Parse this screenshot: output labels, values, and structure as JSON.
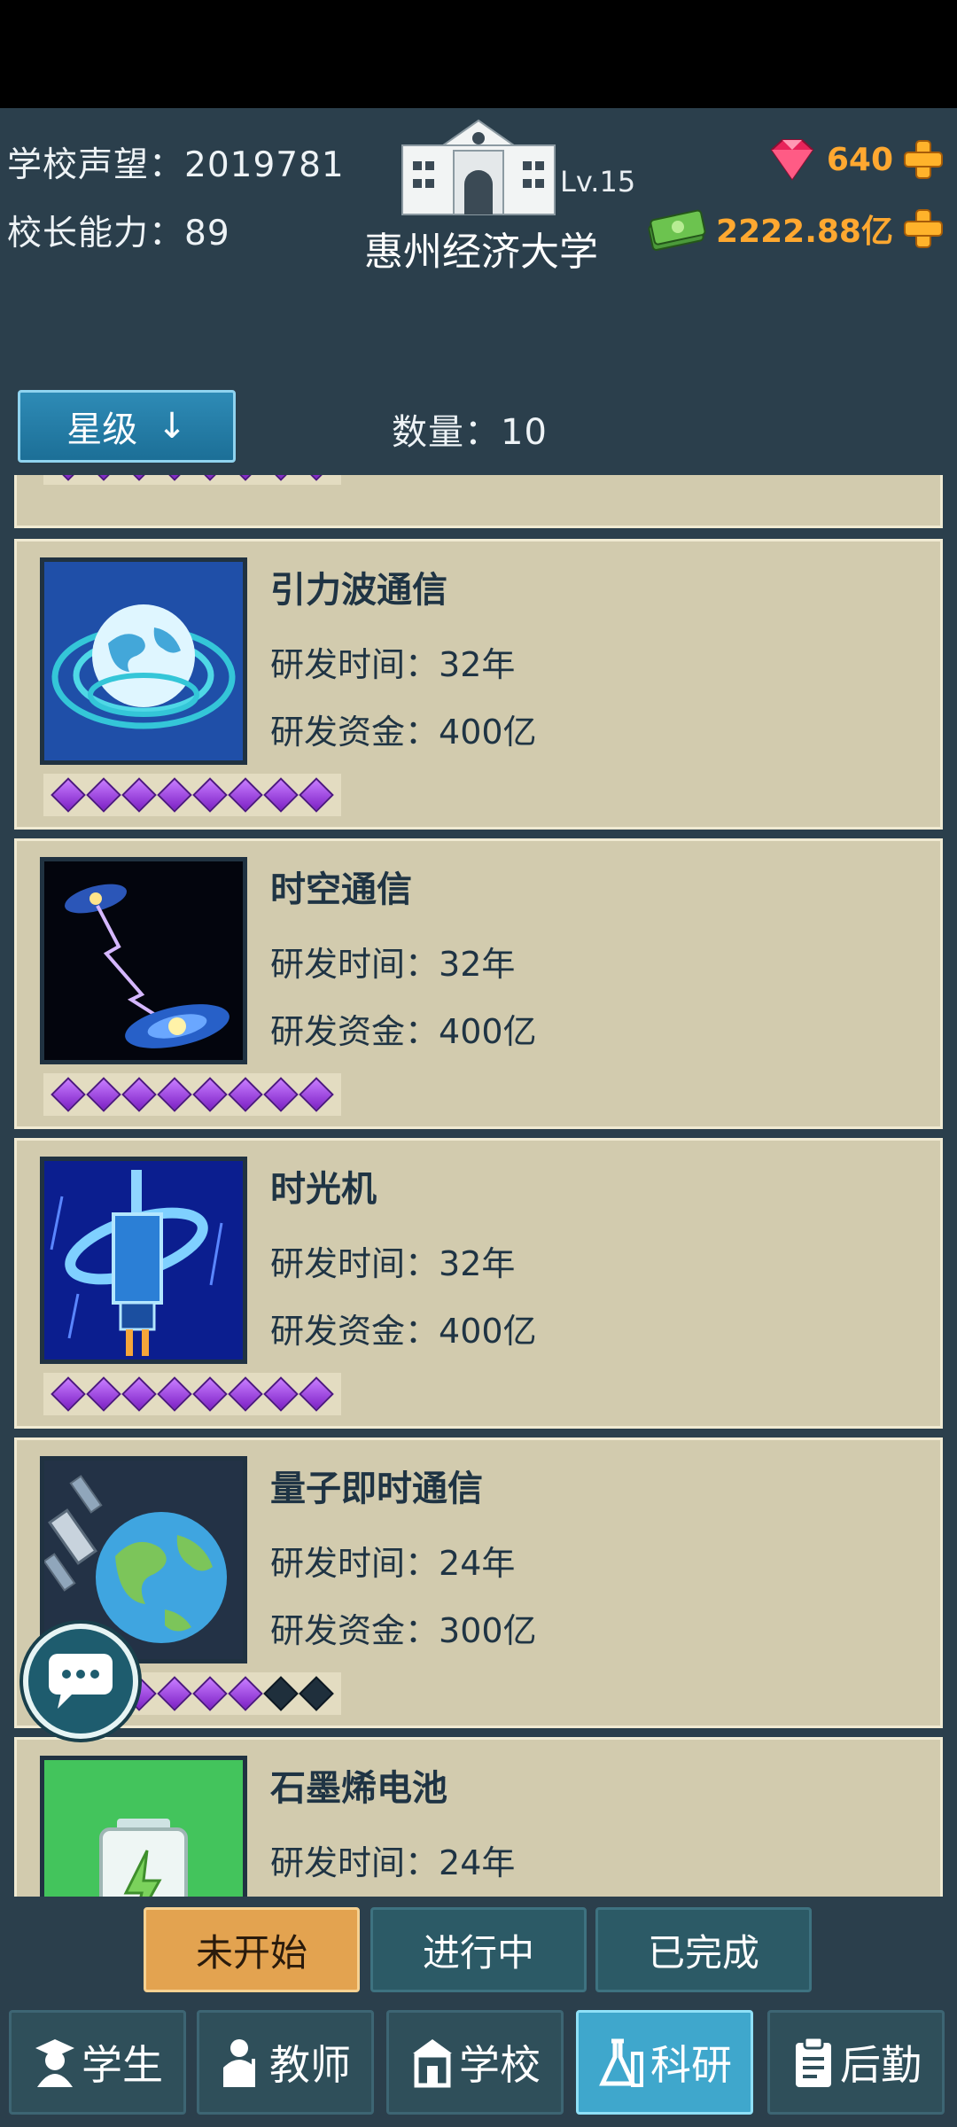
{
  "header": {
    "reputation_label": "学校声望：",
    "reputation_value": "2019781",
    "ability_label": "校长能力：",
    "ability_value": "89",
    "school_level": "Lv.15",
    "school_name": "惠州经济大学",
    "gems": "640",
    "cash": "2222.88亿"
  },
  "toolbar": {
    "sort_label": "星级",
    "sort_arrow": "↓",
    "count_label": "数量：",
    "count_value": "10"
  },
  "research": [
    {
      "name": "引力波通信",
      "time_label": "研发时间：",
      "time": "32年",
      "fund_label": "研发资金：",
      "fund": "400亿",
      "stars_filled": 8,
      "stars_total": 8,
      "icon": "gravitational-wave-icon"
    },
    {
      "name": "时空通信",
      "time_label": "研发时间：",
      "time": "32年",
      "fund_label": "研发资金：",
      "fund": "400亿",
      "stars_filled": 8,
      "stars_total": 8,
      "icon": "galaxy-lightning-icon"
    },
    {
      "name": "时光机",
      "time_label": "研发时间：",
      "time": "32年",
      "fund_label": "研发资金：",
      "fund": "400亿",
      "stars_filled": 8,
      "stars_total": 8,
      "icon": "time-machine-icon"
    },
    {
      "name": "量子即时通信",
      "time_label": "研发时间：",
      "time": "24年",
      "fund_label": "研发资金：",
      "fund": "300亿",
      "stars_filled": 6,
      "stars_total": 8,
      "icon": "satellite-earth-icon"
    },
    {
      "name": "石墨烯电池",
      "time_label": "研发时间：",
      "time": "24年",
      "icon": "battery-icon"
    }
  ],
  "filters": [
    "未开始",
    "进行中",
    "已完成"
  ],
  "nav": [
    "学生",
    "教师",
    "学校",
    "科研",
    "后勤"
  ],
  "colors": {
    "accent": "#3fa7cc",
    "gold": "#ffa830",
    "card": "#d2cbae",
    "star": "#9b3fe0"
  }
}
